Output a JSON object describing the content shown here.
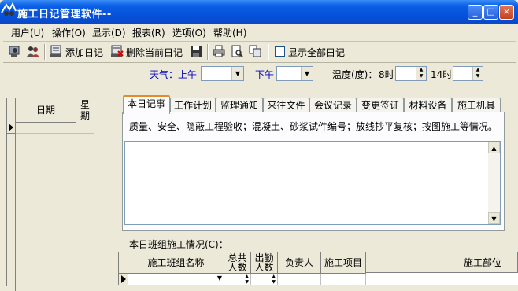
{
  "window": {
    "title": "施工日记管理软件--",
    "controls": {
      "minimize": "_",
      "maximize": "□",
      "close": "×"
    }
  },
  "menu": [
    "用户(U)",
    "操作(O)",
    "显示(D)",
    "报表(R)",
    "选项(O)",
    "帮助(H)"
  ],
  "toolbar": {
    "add_diary": "添加日记",
    "delete_diary": "删除当前日记",
    "show_all": "显示全部日记",
    "show_all_checked": false
  },
  "date_grid": {
    "headers": {
      "date": "日期",
      "weekday": "星期"
    }
  },
  "weather": {
    "label": "天气：",
    "am_label": "上午",
    "am_value": "",
    "pm_label": "下午",
    "pm_value": "",
    "temp_label": "温度(度)：",
    "t8_label": "8时",
    "t8_value": "",
    "t14_label": "14时",
    "t14_value": ""
  },
  "tabs": [
    "本日记事",
    "工作计划",
    "监理通知",
    "来往文件",
    "会议记录",
    "变更签证",
    "材料设备",
    "施工机具"
  ],
  "active_tab": 0,
  "hint_text": "质量、安全、隐蔽工程验收；混凝土、砂浆试件编号；放线抄平复核；按图施工等情况。",
  "memo_value": "",
  "crew": {
    "label": "本日班组施工情况(C)：",
    "headers": [
      "施工班组名称",
      "总共人数",
      "出勤人数",
      "负责人",
      "施工项目",
      "施工部位"
    ],
    "headers_split": {
      "total": [
        "总共",
        "人数"
      ],
      "present": [
        "出勤",
        "人数"
      ]
    }
  },
  "colors": {
    "titlebar": "#0a5ee6",
    "window_bg": "#ece9d8",
    "tab_highlight": "#e68b2c",
    "label_blue": "#0000c0"
  }
}
